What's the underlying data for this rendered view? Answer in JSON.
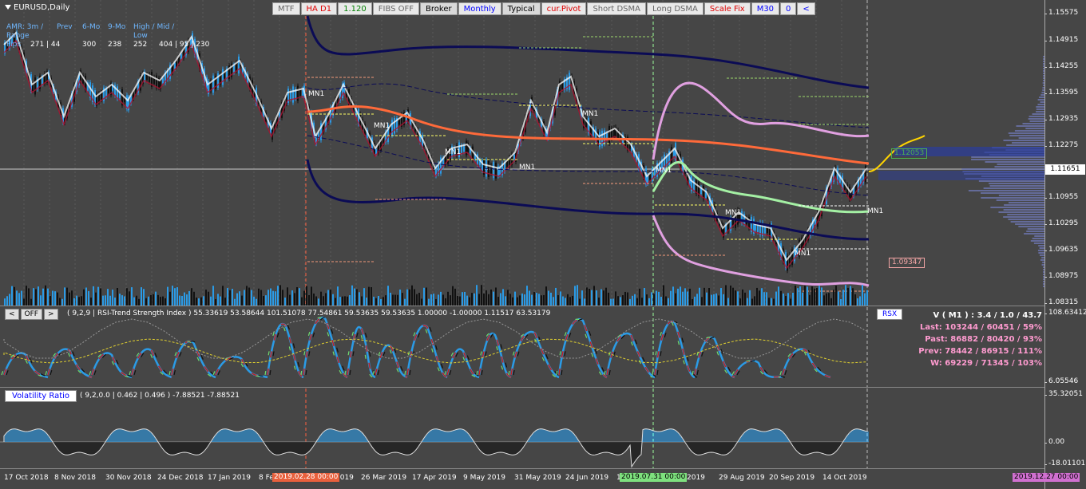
{
  "symbol": "EURUSD,Daily",
  "toolbar": [
    {
      "label": "MTF",
      "style": "gray"
    },
    {
      "label": "HA D1",
      "style": "red"
    },
    {
      "label": "1.120",
      "style": "green"
    },
    {
      "label": "FIBS OFF",
      "style": "gray"
    },
    {
      "label": "Broker",
      "style": "dark"
    },
    {
      "label": "Monthly",
      "style": "blue"
    },
    {
      "label": "Typical",
      "style": "dark"
    },
    {
      "label": "cur.Pivot",
      "style": "red"
    },
    {
      "label": "Short DSMA",
      "style": "gray"
    },
    {
      "label": "Long DSMA",
      "style": "gray"
    },
    {
      "label": "Scale Fix",
      "style": "red"
    },
    {
      "label": "M30",
      "style": "blue"
    },
    {
      "label": "0",
      "style": "blue"
    },
    {
      "label": "<",
      "style": "blue"
    }
  ],
  "stats": {
    "header": [
      "AMR: 3m / Range",
      "Prev",
      "6-Mo",
      "9-Mo",
      "High / Mid / Low"
    ],
    "row_label": "Pips",
    "values": [
      "271 | 44",
      "300",
      "238",
      "252",
      "404 | 95 | 230"
    ]
  },
  "price_scale": [
    "1.15575",
    "1.14915",
    "1.14255",
    "1.13595",
    "1.12935",
    "1.12275",
    "1.11651",
    "1.10955",
    "1.10295",
    "1.09635",
    "1.08975",
    "1.08315"
  ],
  "current_price": "1.11651",
  "price_boxes": [
    {
      "text": "1.12053",
      "color": "#4caf50"
    },
    {
      "text": "1.09347",
      "color": "#f4a6a6"
    }
  ],
  "mn1_label": "MN1",
  "rsi": {
    "prev_btn": "<",
    "off_btn": "OFF",
    "next_btn": ">",
    "title": "( 9,2,9 | RSI-Trend Strength Index ) 55.33619 53.58644 101.51078 77.54861 59.53635 59.53635 1.00000 -1.00000 1.11517 63.53179",
    "rsx_btn": "RSX",
    "scale": [
      "108.63412",
      "6.05546"
    ]
  },
  "volume_stats": {
    "header": "V ( M1 ) : 3.4 / 1.0 / 43.7",
    "rows": [
      "Last: 103244 / 60451 / 59%",
      "Past: 86882 / 80420 / 93%",
      "Prev: 78442 / 86915 / 111%",
      "W: 69229 / 71345 / 103%"
    ]
  },
  "vr": {
    "btn": "Volatility Ratio",
    "title": "( 9,2,0.0 | 0.462 | 0.496 ) -7.88521 -7.88521",
    "scale": [
      "35.32051",
      "0.00",
      "-18.01101"
    ]
  },
  "xaxis": [
    "17 Oct 2018",
    "8 Nov 2018",
    "30 Nov 2018",
    "24 Dec 2018",
    "17 Jan 2019",
    "8 Feb",
    "2019",
    "26 Mar 2019",
    "17 Apr 2019",
    "9 May 2019",
    "31 May 2019",
    "24 Jun 2019",
    "1",
    "2019",
    "29 Aug 2019",
    "20 Sep 2019",
    "14 Oct 2019"
  ],
  "xflags": [
    {
      "text": "2019.02.28 00:00",
      "bg": "#e8603c",
      "fg": "#fff"
    },
    {
      "text": "2019.07.31 00:00",
      "bg": "#7ee07e",
      "fg": "#000"
    },
    {
      "text": "2019.12.27 00:00",
      "bg": "#d070d0",
      "fg": "#000"
    }
  ]
}
